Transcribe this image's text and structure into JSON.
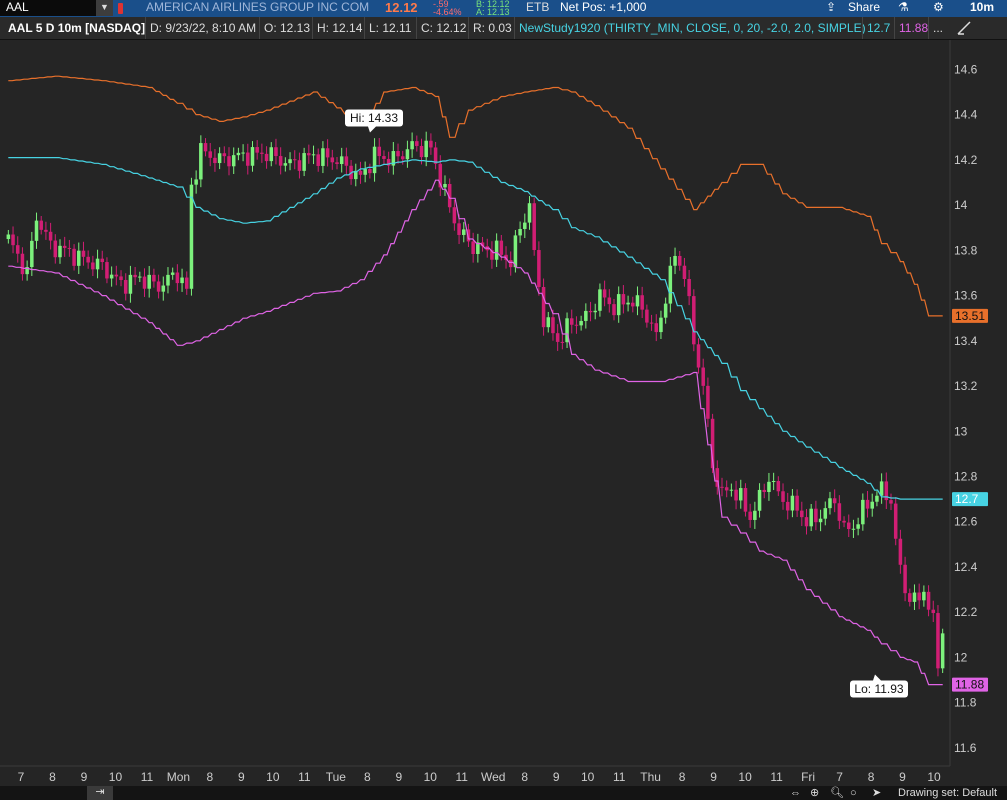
{
  "topbar": {
    "symbol": "AAL",
    "company": "AMERICAN AIRLINES GROUP INC COM",
    "last": "12.12",
    "change": "-.59",
    "change_pct": "-4.64%",
    "bid": "B: 12.12",
    "ask": "A: 12.13",
    "exchange": "ETB",
    "net_pos": "Net Pos: +1,000",
    "share": "Share",
    "timeframe": "10m"
  },
  "infobar": {
    "title": "AAL 5 D 10m [NASDAQ]",
    "date": "D: 9/23/22, 8:10 AM",
    "open": "O: 12.13",
    "high": "H: 12.14",
    "low": "L: 12.11",
    "close": "C: 12.12",
    "range": "R: 0.03",
    "study": "NewStudy1920 (THIRTY_MIN, CLOSE, 0, 20, -2.0, 2.0, SIMPLE)",
    "study_mid": "12.7",
    "study_low": "11.88",
    "more": "..."
  },
  "bottombar": {
    "drawing_set": "Drawing set: Default"
  },
  "colors": {
    "background": "#252525",
    "bull": "#7cf07c",
    "bear": "#d11e74",
    "upper_band": "#e8702b",
    "middle_band": "#47d3e3",
    "lower_band": "#e064e6",
    "axis_text": "#cccccc"
  },
  "chart_data": {
    "type": "candlestick",
    "symbol": "AAL",
    "interval": "10m",
    "x_labels": [
      "7",
      "8",
      "9",
      "10",
      "11",
      "Mon",
      "8",
      "9",
      "10",
      "11",
      "Tue",
      "8",
      "9",
      "10",
      "11",
      "Wed",
      "8",
      "9",
      "10",
      "11",
      "Thu",
      "8",
      "9",
      "10",
      "11",
      "Fri",
      "7",
      "8",
      "9",
      "10"
    ],
    "y_ticks": [
      11.6,
      11.8,
      12,
      12.2,
      12.4,
      12.6,
      12.8,
      13,
      13.2,
      13.4,
      13.6,
      13.8,
      14,
      14.2,
      14.4,
      14.6
    ],
    "y_range": [
      11.52,
      14.73
    ],
    "grid": false,
    "hi_annotation": "Hi: 14.33",
    "lo_annotation": "Lo: 11.93",
    "price_labels": [
      {
        "series": "upper_band",
        "value": "13.51"
      },
      {
        "series": "middle_band",
        "value": "12.7"
      },
      {
        "series": "lower_band",
        "value": "11.88"
      }
    ],
    "candle_anchors": [
      {
        "i": 0,
        "c": 13.85
      },
      {
        "i": 4,
        "c": 13.7
      },
      {
        "i": 6,
        "c": 13.95
      },
      {
        "i": 9,
        "c": 13.82
      },
      {
        "i": 12,
        "c": 13.8
      },
      {
        "i": 16,
        "c": 13.76
      },
      {
        "i": 20,
        "c": 13.73
      },
      {
        "i": 24,
        "c": 13.65
      },
      {
        "i": 28,
        "c": 13.68
      },
      {
        "i": 32,
        "c": 13.64
      },
      {
        "i": 36,
        "c": 13.7
      },
      {
        "i": 38,
        "c": 13.62
      },
      {
        "i": 39,
        "c": 14.08
      },
      {
        "i": 41,
        "c": 14.24
      },
      {
        "i": 45,
        "c": 14.2
      },
      {
        "i": 50,
        "c": 14.22
      },
      {
        "i": 55,
        "c": 14.23
      },
      {
        "i": 60,
        "c": 14.18
      },
      {
        "i": 65,
        "c": 14.22
      },
      {
        "i": 70,
        "c": 14.2
      },
      {
        "i": 75,
        "c": 14.12
      },
      {
        "i": 78,
        "c": 14.22
      },
      {
        "i": 82,
        "c": 14.2
      },
      {
        "i": 86,
        "c": 14.26
      },
      {
        "i": 90,
        "c": 14.25
      },
      {
        "i": 93,
        "c": 14.05
      },
      {
        "i": 96,
        "c": 13.88
      },
      {
        "i": 99,
        "c": 13.82
      },
      {
        "i": 102,
        "c": 13.8
      },
      {
        "i": 104,
        "c": 13.8
      },
      {
        "i": 107,
        "c": 13.75
      },
      {
        "i": 109,
        "c": 13.9
      },
      {
        "i": 111,
        "c": 14.0
      },
      {
        "i": 112,
        "c": 13.78
      },
      {
        "i": 114,
        "c": 13.5
      },
      {
        "i": 117,
        "c": 13.4
      },
      {
        "i": 120,
        "c": 13.48
      },
      {
        "i": 123,
        "c": 13.5
      },
      {
        "i": 126,
        "c": 13.6
      },
      {
        "i": 129,
        "c": 13.55
      },
      {
        "i": 132,
        "c": 13.58
      },
      {
        "i": 135,
        "c": 13.55
      },
      {
        "i": 138,
        "c": 13.42
      },
      {
        "i": 140,
        "c": 13.6
      },
      {
        "i": 142,
        "c": 13.78
      },
      {
        "i": 144,
        "c": 13.7
      },
      {
        "i": 146,
        "c": 13.4
      },
      {
        "i": 148,
        "c": 13.2
      },
      {
        "i": 150,
        "c": 12.85
      },
      {
        "i": 152,
        "c": 12.72
      },
      {
        "i": 154,
        "c": 12.75
      },
      {
        "i": 156,
        "c": 12.7
      },
      {
        "i": 158,
        "c": 12.62
      },
      {
        "i": 160,
        "c": 12.7
      },
      {
        "i": 162,
        "c": 12.8
      },
      {
        "i": 164,
        "c": 12.72
      },
      {
        "i": 166,
        "c": 12.68
      },
      {
        "i": 168,
        "c": 12.66
      },
      {
        "i": 170,
        "c": 12.6
      },
      {
        "i": 173,
        "c": 12.63
      },
      {
        "i": 176,
        "c": 12.7
      },
      {
        "i": 178,
        "c": 12.56
      },
      {
        "i": 180,
        "c": 12.58
      },
      {
        "i": 183,
        "c": 12.68
      },
      {
        "i": 186,
        "c": 12.74
      },
      {
        "i": 188,
        "c": 12.7
      },
      {
        "i": 189,
        "c": 12.5
      },
      {
        "i": 191,
        "c": 12.3
      },
      {
        "i": 193,
        "c": 12.24
      },
      {
        "i": 195,
        "c": 12.3
      },
      {
        "i": 197,
        "c": 12.15
      },
      {
        "i": 198,
        "c": 11.98
      },
      {
        "i": 199,
        "c": 12.12
      }
    ],
    "series": [
      {
        "name": "upper_band",
        "x": [
          0,
          10,
          20,
          30,
          36,
          40,
          45,
          50,
          55,
          60,
          65,
          70,
          75,
          80,
          86,
          91,
          94,
          98,
          105,
          110,
          116,
          120,
          125,
          132,
          139,
          146,
          152,
          156,
          160,
          165,
          170,
          177,
          183,
          186,
          190,
          193,
          196,
          199
        ],
        "y": [
          14.55,
          14.57,
          14.55,
          14.52,
          14.45,
          14.4,
          14.37,
          14.39,
          14.42,
          14.46,
          14.5,
          14.43,
          14.35,
          14.5,
          14.52,
          14.48,
          14.3,
          14.42,
          14.48,
          14.5,
          14.52,
          14.5,
          14.44,
          14.34,
          14.16,
          13.98,
          14.1,
          14.18,
          14.18,
          14.05,
          13.99,
          13.99,
          13.95,
          13.83,
          13.75,
          13.65,
          13.51,
          13.51
        ]
      },
      {
        "name": "middle_band",
        "x": [
          0,
          10,
          20,
          30,
          36,
          40,
          45,
          50,
          55,
          60,
          65,
          70,
          75,
          80,
          86,
          91,
          94,
          98,
          105,
          110,
          116,
          120,
          125,
          132,
          139,
          146,
          152,
          156,
          160,
          165,
          170,
          177,
          183,
          186,
          190,
          193,
          196,
          199
        ],
        "y": [
          14.21,
          14.21,
          14.18,
          14.12,
          14.08,
          13.99,
          13.94,
          13.92,
          13.93,
          13.99,
          14.05,
          14.12,
          14.16,
          14.18,
          14.2,
          14.19,
          14.2,
          14.19,
          14.1,
          14.06,
          13.98,
          13.9,
          13.86,
          13.77,
          13.67,
          13.44,
          13.3,
          13.18,
          13.1,
          13.0,
          12.93,
          12.84,
          12.77,
          12.71,
          12.7,
          12.7,
          12.7,
          12.7
        ]
      },
      {
        "name": "lower_band",
        "x": [
          0,
          10,
          20,
          30,
          36,
          40,
          45,
          50,
          55,
          60,
          65,
          70,
          75,
          80,
          86,
          91,
          94,
          98,
          105,
          110,
          116,
          120,
          125,
          132,
          139,
          146,
          152,
          156,
          160,
          165,
          170,
          177,
          183,
          186,
          190,
          193,
          196,
          199
        ],
        "y": [
          13.73,
          13.7,
          13.6,
          13.48,
          13.38,
          13.4,
          13.45,
          13.5,
          13.53,
          13.57,
          13.61,
          13.62,
          13.67,
          13.78,
          13.98,
          14.11,
          14.03,
          13.85,
          13.77,
          13.7,
          13.52,
          13.34,
          13.27,
          13.22,
          13.22,
          13.26,
          12.62,
          12.55,
          12.47,
          12.43,
          12.3,
          12.18,
          12.12,
          12.06,
          12.0,
          11.98,
          11.88,
          11.88
        ]
      }
    ]
  }
}
